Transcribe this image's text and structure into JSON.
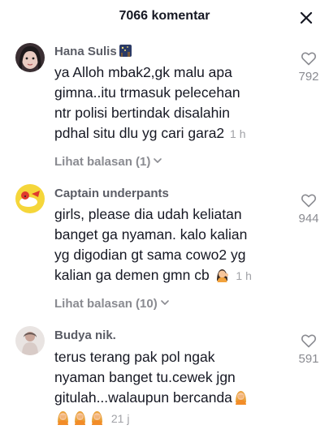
{
  "header": {
    "title": "7066 komentar"
  },
  "comments": [
    {
      "username": "Hana Sulis",
      "lines": [
        "ya Alloh mbak2,gk malu apa",
        "gimna..itu trmasuk pelecehan",
        "ntr polisi bertindak disalahin",
        "pdhal situ dlu yg cari gara2"
      ],
      "time": "1 h",
      "likes": "792",
      "replies": "Lihat balasan (1)"
    },
    {
      "username": "Captain underpants",
      "lines": [
        "girls, please dia udah keliatan",
        "banget ga nyaman. kalo kalian",
        "yg digodian gt sama cowo2 yg",
        "kalian ga demen gmn cb"
      ],
      "time": "1 h",
      "likes": "944",
      "replies": "Lihat balasan (10)"
    },
    {
      "username": "Budya nik.",
      "lines": [
        "terus terang pak pol ngak",
        "nyaman banget tu.cewek jgn",
        "gitulah...walaupun bercanda"
      ],
      "time": "21 j",
      "likes": "591"
    }
  ],
  "icons": {
    "close": "close-icon",
    "heart": "heart-outline-icon",
    "chevron": "chevron-down-icon",
    "emoji_woman": "woman-tipping-hand-emoji",
    "emoji_facepalm": "facepalm-emoji",
    "badge": "starry-night-emoji"
  },
  "colors": {
    "username": "#5b5d66",
    "muted": "#8a8b91",
    "text": "#161823"
  }
}
